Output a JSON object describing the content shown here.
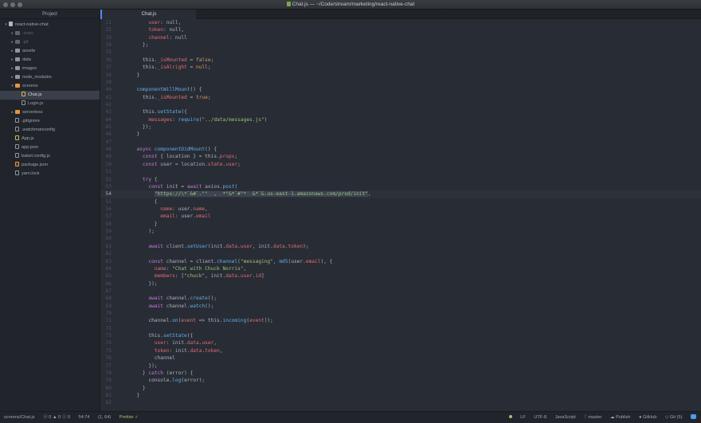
{
  "window": {
    "title": "Chat.js — ~/Code/stream/marketing/react-native-chat"
  },
  "sidebar": {
    "header": "Project",
    "items": [
      {
        "label": "react-native-chat",
        "depth": 0,
        "kind": "repo",
        "expanded": true
      },
      {
        "label": ".expo",
        "depth": 1,
        "kind": "folder-dim",
        "expanded": false,
        "dim": true
      },
      {
        "label": ".git",
        "depth": 1,
        "kind": "folder-dim",
        "expanded": false,
        "dim": true
      },
      {
        "label": "assets",
        "depth": 1,
        "kind": "folder",
        "expanded": false
      },
      {
        "label": "data",
        "depth": 1,
        "kind": "folder",
        "expanded": false
      },
      {
        "label": "images",
        "depth": 1,
        "kind": "folder",
        "expanded": false
      },
      {
        "label": "node_modules",
        "depth": 1,
        "kind": "folder",
        "expanded": false
      },
      {
        "label": "screens",
        "depth": 1,
        "kind": "folder-orange",
        "expanded": true
      },
      {
        "label": "Chat.js",
        "depth": 2,
        "kind": "file-js",
        "selected": true
      },
      {
        "label": "Login.js",
        "depth": 2,
        "kind": "file"
      },
      {
        "label": "serverless",
        "depth": 1,
        "kind": "folder-orange",
        "expanded": false
      },
      {
        "label": ".gitignore",
        "depth": 1,
        "kind": "file"
      },
      {
        "label": ".watchmanconfig",
        "depth": 1,
        "kind": "file"
      },
      {
        "label": "App.js",
        "depth": 1,
        "kind": "file-js"
      },
      {
        "label": "app.json",
        "depth": 1,
        "kind": "file"
      },
      {
        "label": "babel.config.js",
        "depth": 1,
        "kind": "file"
      },
      {
        "label": "package.json",
        "depth": 1,
        "kind": "file-json"
      },
      {
        "label": "yarn.lock",
        "depth": 1,
        "kind": "file"
      }
    ]
  },
  "editor": {
    "tab": "Chat.js",
    "current_line": 54,
    "lines": [
      {
        "n": 31,
        "t": [
          [
            "      ",
            "src"
          ],
          [
            "user",
            "prop"
          ],
          [
            ": null,",
            "src"
          ]
        ]
      },
      {
        "n": 32,
        "t": [
          [
            "      ",
            "src"
          ],
          [
            "token",
            "prop"
          ],
          [
            ": null,",
            "src"
          ]
        ]
      },
      {
        "n": 33,
        "t": [
          [
            "      ",
            "src"
          ],
          [
            "channel",
            "prop"
          ],
          [
            ": null",
            "src"
          ]
        ]
      },
      {
        "n": 34,
        "t": [
          [
            "    };",
            "src"
          ]
        ]
      },
      {
        "n": 35,
        "t": []
      },
      {
        "n": 36,
        "t": [
          [
            "    this.",
            "src"
          ],
          [
            "_isMounted",
            "prop"
          ],
          [
            " = ",
            "src"
          ],
          [
            "false",
            "num"
          ],
          [
            ";",
            "src"
          ]
        ]
      },
      {
        "n": 37,
        "t": [
          [
            "    this.",
            "src"
          ],
          [
            "_isAlright",
            "prop"
          ],
          [
            " = ",
            "src"
          ],
          [
            "null",
            "num"
          ],
          [
            ";",
            "src"
          ]
        ]
      },
      {
        "n": 38,
        "t": [
          [
            "  }",
            "src"
          ]
        ]
      },
      {
        "n": 39,
        "t": []
      },
      {
        "n": 40,
        "t": [
          [
            "  ",
            "src"
          ],
          [
            "componentWillMount",
            "fn"
          ],
          [
            "() {",
            "src"
          ]
        ]
      },
      {
        "n": 41,
        "t": [
          [
            "    this.",
            "src"
          ],
          [
            "_isMounted",
            "prop"
          ],
          [
            " = ",
            "src"
          ],
          [
            "true",
            "num"
          ],
          [
            ";",
            "src"
          ]
        ]
      },
      {
        "n": 42,
        "t": []
      },
      {
        "n": 43,
        "t": [
          [
            "    this.",
            "src"
          ],
          [
            "setState",
            "fn"
          ],
          [
            "({",
            "src"
          ]
        ]
      },
      {
        "n": 44,
        "t": [
          [
            "      ",
            "src"
          ],
          [
            "messages",
            "prop"
          ],
          [
            ": ",
            "src"
          ],
          [
            "require",
            "fn"
          ],
          [
            "(",
            "src"
          ],
          [
            "\"../data/messages.js\"",
            "str"
          ],
          [
            ")",
            "src"
          ]
        ]
      },
      {
        "n": 45,
        "t": [
          [
            "    });",
            "src"
          ]
        ]
      },
      {
        "n": 46,
        "t": [
          [
            "  }",
            "src"
          ]
        ]
      },
      {
        "n": 47,
        "t": []
      },
      {
        "n": 48,
        "t": [
          [
            "  ",
            "src"
          ],
          [
            "async",
            "kw"
          ],
          [
            " ",
            "src"
          ],
          [
            "componentDidMount",
            "fn"
          ],
          [
            "() {",
            "src"
          ]
        ]
      },
      {
        "n": 49,
        "t": [
          [
            "    ",
            "src"
          ],
          [
            "const",
            "kw"
          ],
          [
            " { location } = this.",
            "src"
          ],
          [
            "props",
            "prop"
          ],
          [
            ";",
            "src"
          ]
        ]
      },
      {
        "n": 50,
        "t": [
          [
            "    ",
            "src"
          ],
          [
            "const",
            "kw"
          ],
          [
            " user = location.",
            "src"
          ],
          [
            "state",
            "prop"
          ],
          [
            ".",
            "src"
          ],
          [
            "user",
            "prop"
          ],
          [
            ";",
            "src"
          ]
        ]
      },
      {
        "n": 51,
        "t": []
      },
      {
        "n": 52,
        "t": [
          [
            "    ",
            "src"
          ],
          [
            "try",
            "kw"
          ],
          [
            " {",
            "src"
          ]
        ]
      },
      {
        "n": 53,
        "t": [
          [
            "      ",
            "src"
          ],
          [
            "const",
            "kw"
          ],
          [
            " init = ",
            "src"
          ],
          [
            "await",
            "kw"
          ],
          [
            " axios.",
            "src"
          ],
          [
            "post",
            "fn"
          ],
          [
            "(",
            "src"
          ]
        ]
      },
      {
        "n": 54,
        "t": [
          [
            "        ",
            "src"
          ],
          [
            "\"https://\\*`&#`.\"\"  ,  *\"&*`#\"*  &*`&.us-east-1.amazonaws.com/prod/init\"",
            "str sel"
          ],
          [
            ",",
            "src"
          ]
        ]
      },
      {
        "n": 55,
        "t": [
          [
            "        {",
            "src"
          ]
        ]
      },
      {
        "n": 56,
        "t": [
          [
            "          ",
            "src"
          ],
          [
            "name",
            "prop"
          ],
          [
            ": user.",
            "src"
          ],
          [
            "name",
            "prop"
          ],
          [
            ",",
            "src"
          ]
        ]
      },
      {
        "n": 57,
        "t": [
          [
            "          ",
            "src"
          ],
          [
            "email",
            "prop"
          ],
          [
            ": user.",
            "src"
          ],
          [
            "email",
            "prop"
          ]
        ]
      },
      {
        "n": 58,
        "t": [
          [
            "        }",
            "src"
          ]
        ]
      },
      {
        "n": 59,
        "t": [
          [
            "      );",
            "src"
          ]
        ]
      },
      {
        "n": 60,
        "t": []
      },
      {
        "n": 61,
        "t": [
          [
            "      ",
            "src"
          ],
          [
            "await",
            "kw"
          ],
          [
            " client.",
            "src"
          ],
          [
            "setUser",
            "fn"
          ],
          [
            "(init.",
            "src"
          ],
          [
            "data",
            "prop"
          ],
          [
            ".",
            "src"
          ],
          [
            "user",
            "prop"
          ],
          [
            ", init.",
            "src"
          ],
          [
            "data",
            "prop"
          ],
          [
            ".",
            "src"
          ],
          [
            "token",
            "prop"
          ],
          [
            ");",
            "src"
          ]
        ]
      },
      {
        "n": 62,
        "t": []
      },
      {
        "n": 63,
        "t": [
          [
            "      ",
            "src"
          ],
          [
            "const",
            "kw"
          ],
          [
            " channel = client.",
            "src"
          ],
          [
            "channel",
            "fn"
          ],
          [
            "(",
            "src"
          ],
          [
            "\"messaging\"",
            "str"
          ],
          [
            ", ",
            "src"
          ],
          [
            "md5",
            "fn"
          ],
          [
            "(user.",
            "src"
          ],
          [
            "email",
            "prop"
          ],
          [
            "), {",
            "src"
          ]
        ]
      },
      {
        "n": 64,
        "t": [
          [
            "        ",
            "src"
          ],
          [
            "name",
            "prop"
          ],
          [
            ": ",
            "src"
          ],
          [
            "\"Chat with Chuck Norris\"",
            "str"
          ],
          [
            ",",
            "src"
          ]
        ]
      },
      {
        "n": 65,
        "t": [
          [
            "        ",
            "src"
          ],
          [
            "members",
            "prop"
          ],
          [
            ": [",
            "src"
          ],
          [
            "\"chuck\"",
            "str"
          ],
          [
            ", init.",
            "src"
          ],
          [
            "data",
            "prop"
          ],
          [
            ".",
            "src"
          ],
          [
            "user",
            "prop"
          ],
          [
            ".",
            "src"
          ],
          [
            "id",
            "prop"
          ],
          [
            "]",
            "src"
          ]
        ]
      },
      {
        "n": 66,
        "t": [
          [
            "      });",
            "src"
          ]
        ]
      },
      {
        "n": 67,
        "t": []
      },
      {
        "n": 68,
        "t": [
          [
            "      ",
            "src"
          ],
          [
            "await",
            "kw"
          ],
          [
            " channel.",
            "src"
          ],
          [
            "create",
            "fn"
          ],
          [
            "();",
            "src"
          ]
        ]
      },
      {
        "n": 69,
        "t": [
          [
            "      ",
            "src"
          ],
          [
            "await",
            "kw"
          ],
          [
            " channel.",
            "src"
          ],
          [
            "watch",
            "fn"
          ],
          [
            "();",
            "src"
          ]
        ]
      },
      {
        "n": 70,
        "t": []
      },
      {
        "n": 71,
        "t": [
          [
            "      channel.",
            "src"
          ],
          [
            "on",
            "fn"
          ],
          [
            "(",
            "src"
          ],
          [
            "event",
            "prop"
          ],
          [
            " => this.",
            "src"
          ],
          [
            "incoming",
            "fn"
          ],
          [
            "(",
            "src"
          ],
          [
            "event",
            "prop"
          ],
          [
            "));",
            "src"
          ]
        ]
      },
      {
        "n": 72,
        "t": []
      },
      {
        "n": 73,
        "t": [
          [
            "      this.",
            "src"
          ],
          [
            "setState",
            "fn"
          ],
          [
            "({",
            "src"
          ]
        ]
      },
      {
        "n": 74,
        "t": [
          [
            "        ",
            "src"
          ],
          [
            "user",
            "prop"
          ],
          [
            ": init.",
            "src"
          ],
          [
            "data",
            "prop"
          ],
          [
            ".",
            "src"
          ],
          [
            "user",
            "prop"
          ],
          [
            ",",
            "src"
          ]
        ]
      },
      {
        "n": 75,
        "t": [
          [
            "        ",
            "src"
          ],
          [
            "token",
            "prop"
          ],
          [
            ": init.",
            "src"
          ],
          [
            "data",
            "prop"
          ],
          [
            ".",
            "src"
          ],
          [
            "token",
            "prop"
          ],
          [
            ",",
            "src"
          ]
        ]
      },
      {
        "n": 76,
        "t": [
          [
            "        channel",
            "src"
          ]
        ]
      },
      {
        "n": 77,
        "t": [
          [
            "      });",
            "src"
          ]
        ]
      },
      {
        "n": 78,
        "t": [
          [
            "    } ",
            "src"
          ],
          [
            "catch",
            "kw"
          ],
          [
            " (error) {",
            "src"
          ]
        ]
      },
      {
        "n": 79,
        "t": [
          [
            "      console.",
            "src"
          ],
          [
            "log",
            "fn"
          ],
          [
            "(error);",
            "src"
          ]
        ]
      },
      {
        "n": 80,
        "t": [
          [
            "    }",
            "src"
          ]
        ]
      },
      {
        "n": 81,
        "t": [
          [
            "  }",
            "src"
          ]
        ]
      },
      {
        "n": 82,
        "t": []
      }
    ]
  },
  "statusbar": {
    "path": "screens/Chat.js",
    "diagnostics": "ⓧ 0 ▲ 0 ⓘ 0",
    "cursor": "54:74",
    "selection": "(1, 64)",
    "prettier": "Prettier ✓",
    "line_ending": "LF",
    "encoding": "UTF-8",
    "grammar": "JavaScript",
    "branch": "master",
    "publish": "Publish",
    "github": "GitHub",
    "git": "Git (5)"
  }
}
